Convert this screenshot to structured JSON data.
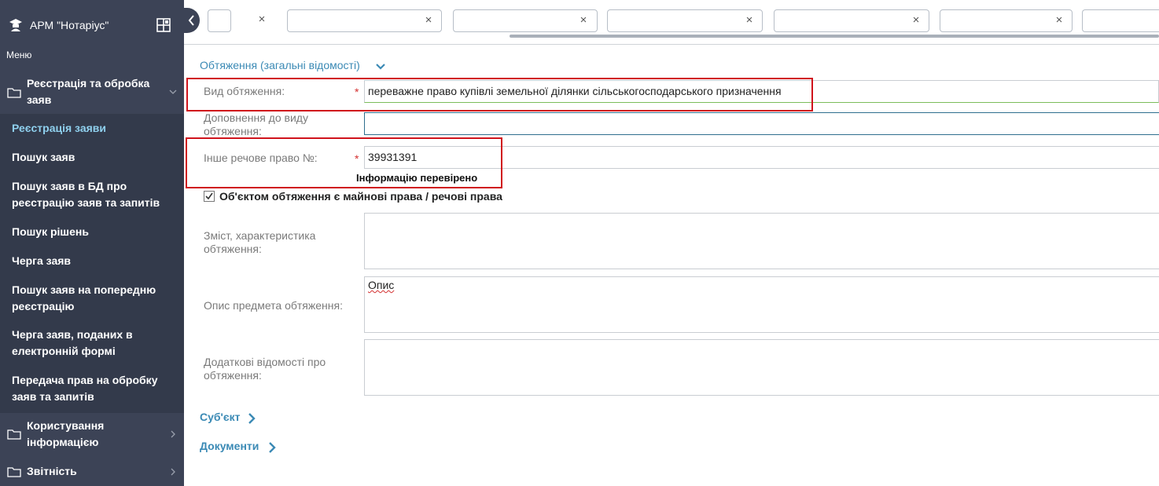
{
  "app": {
    "title": "АРМ \"Нотаріус\"",
    "menu_caption": "Меню"
  },
  "sidebar": {
    "groups": [
      {
        "label": "Реєстрація та обробка заяв"
      },
      {
        "label": "Користування інформацією"
      },
      {
        "label": "Звітність"
      }
    ],
    "items": [
      {
        "label": "Реєстрація заяви",
        "active": true
      },
      {
        "label": "Пошук заяв"
      },
      {
        "label": "Пошук заяв в БД про реєстрацію заяв та запитів"
      },
      {
        "label": "Пошук рішень"
      },
      {
        "label": "Черга заяв"
      },
      {
        "label": "Пошук заяв на попередню реєстрацію"
      },
      {
        "label": "Черга заяв, поданих в електронній формі"
      },
      {
        "label": "Передача прав на обробку заяв та запитів"
      }
    ]
  },
  "tabs": [
    {
      "label": ""
    },
    {
      "label": ""
    },
    {
      "label": ""
    },
    {
      "label": ""
    },
    {
      "label": ""
    },
    {
      "label": ""
    },
    {
      "label": ""
    }
  ],
  "form": {
    "section_general": "Обтяження (загальні відомості)",
    "encumbrance_type": {
      "label": "Вид обтяження:",
      "value": "переважне право купівлі земельної ділянки сільськогосподарського призначення"
    },
    "type_addition": {
      "label": "Доповнення до виду обтяження:",
      "value": ""
    },
    "other_right": {
      "label": "Інше речове право №:",
      "value": "39931391"
    },
    "verified_text": "Інформацію перевірено",
    "object_checkbox": {
      "label": "Об'єктом обтяження є майнові права / речові права",
      "checked": true
    },
    "content": {
      "label": "Зміст, характеристика обтяження:",
      "value": ""
    },
    "subject_description": {
      "label": "Опис предмета обтяження:",
      "value": "Опис"
    },
    "additional_info": {
      "label": "Додаткові відомості про обтяження:",
      "value": ""
    },
    "section_subject": "Суб'єкт",
    "section_documents": "Документи"
  },
  "colors": {
    "sidebar": "#3c4356",
    "accent": "#3b8ab5",
    "highlight": "#d0141c",
    "active_item": "#8fd0ee"
  }
}
